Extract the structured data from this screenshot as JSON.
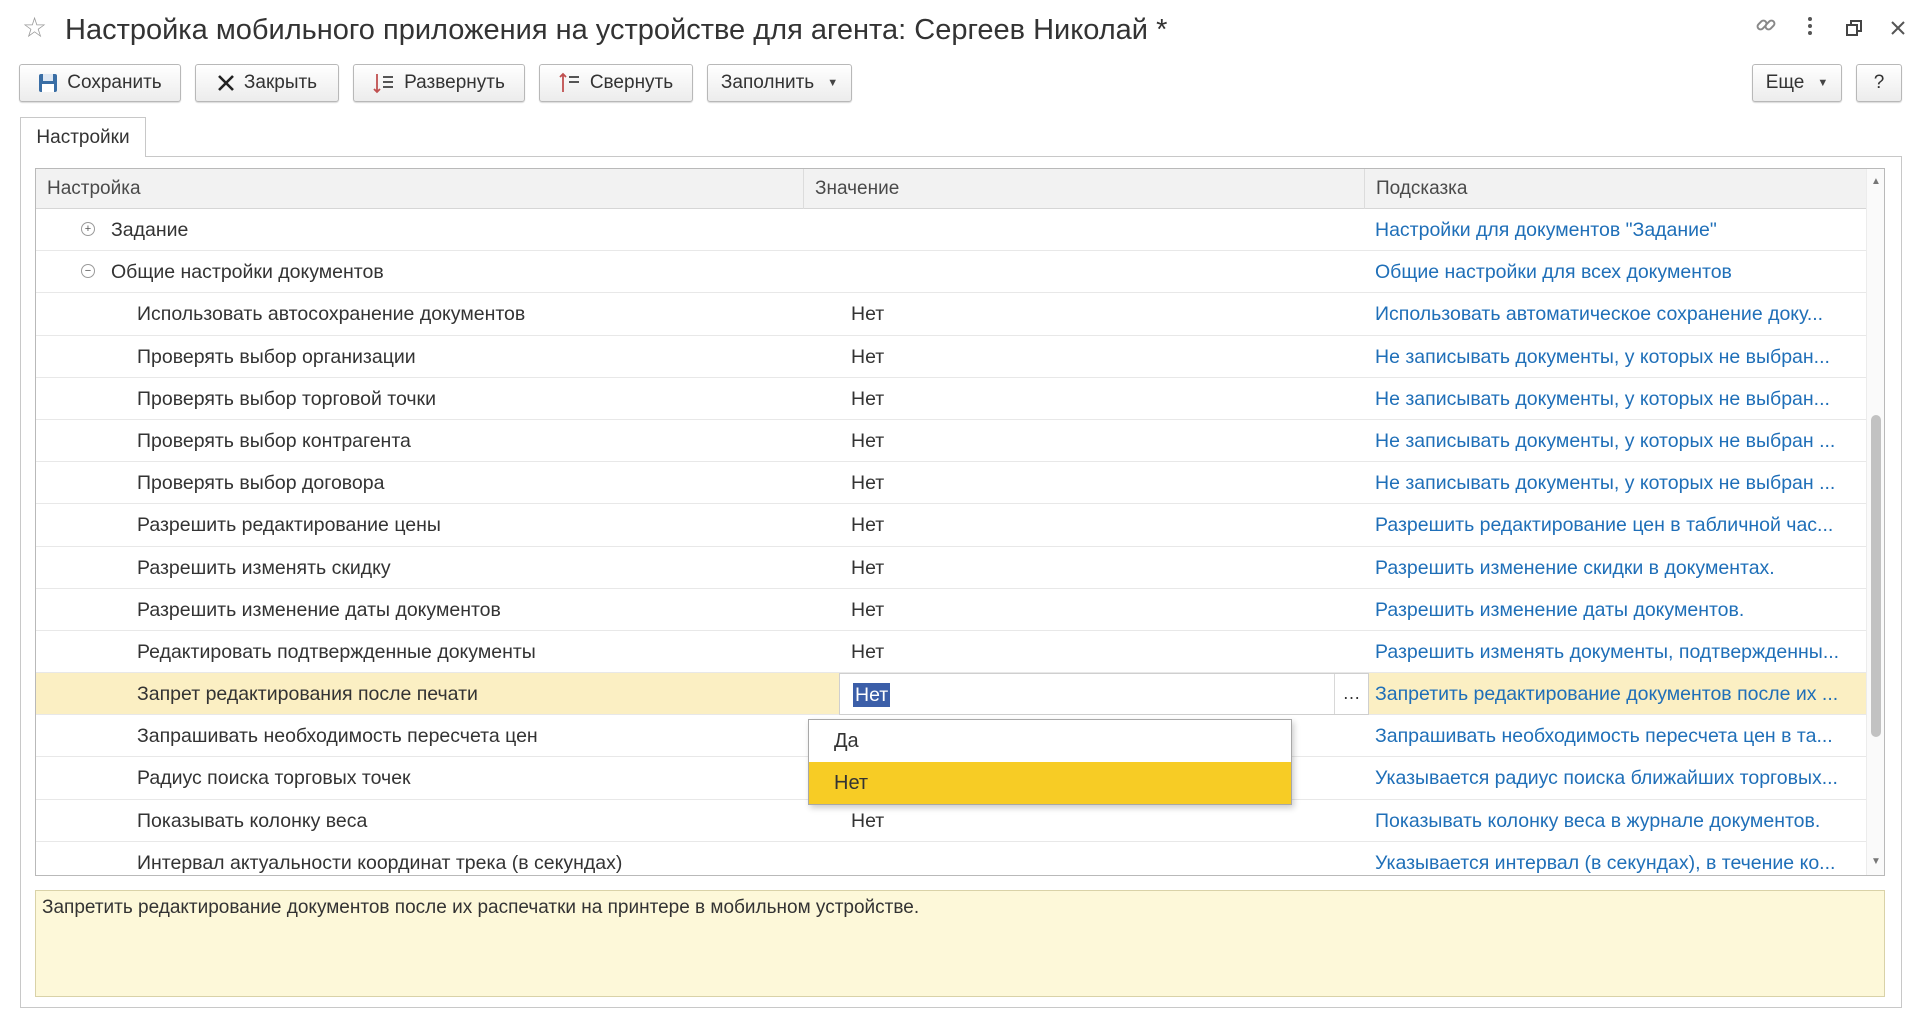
{
  "window": {
    "title": "Настройка мобильного приложения на устройстве для агента: Сергеев Николай *",
    "icons": [
      "star-icon",
      "link-icon",
      "more-vertical-icon",
      "restore-icon",
      "close-icon"
    ]
  },
  "toolbar": {
    "save_label": "Сохранить",
    "close_label": "Закрыть",
    "expand_label": "Развернуть",
    "collapse_label": "Свернуть",
    "fill_label": "Заполнить",
    "more_label": "Еще",
    "help_label": "?"
  },
  "tabs": [
    {
      "label": "Настройки"
    }
  ],
  "table": {
    "columns": [
      "Настройка",
      "Значение",
      "Подсказка"
    ],
    "rows": [
      {
        "setting": "Задание",
        "value": "",
        "hint": "Настройки для документов \"Задание\"",
        "group": true,
        "expanded": false
      },
      {
        "setting": "Общие настройки документов",
        "value": "",
        "hint": "Общие настройки для всех документов",
        "group": true,
        "expanded": true
      },
      {
        "setting": "Использовать автосохранение документов",
        "value": "Нет",
        "hint": "Использовать автоматическое сохранение доку..."
      },
      {
        "setting": "Проверять выбор организации",
        "value": "Нет",
        "hint": "Не записывать документы, у которых не выбран..."
      },
      {
        "setting": "Проверять выбор торговой точки",
        "value": "Нет",
        "hint": "Не записывать документы, у которых не выбран..."
      },
      {
        "setting": "Проверять выбор контрагента",
        "value": "Нет",
        "hint": "Не записывать документы, у которых не выбран ..."
      },
      {
        "setting": "Проверять выбор договора",
        "value": "Нет",
        "hint": "Не записывать документы, у которых не выбран ..."
      },
      {
        "setting": "Разрешить редактирование цены",
        "value": "Нет",
        "hint": "Разрешить редактирование цен в табличной час..."
      },
      {
        "setting": "Разрешить изменять скидку",
        "value": "Нет",
        "hint": "Разрешить изменение скидки в документах."
      },
      {
        "setting": "Разрешить изменение даты документов",
        "value": "Нет",
        "hint": "Разрешить изменение даты документов."
      },
      {
        "setting": "Редактировать подтвержденные документы",
        "value": "Нет",
        "hint": "Разрешить изменять документы, подтвержденны..."
      },
      {
        "setting": "Запрет редактирования после печати",
        "value": "Нет",
        "hint": "Запретить редактирование документов после их ...",
        "selected": true
      },
      {
        "setting": "Запрашивать необходимость пересчета цен",
        "value": "",
        "hint": "Запрашивать необходимость пересчета цен в та..."
      },
      {
        "setting": "Радиус поиска торговых точек",
        "value": "",
        "hint": "Указывается радиус поиска ближайших торговых..."
      },
      {
        "setting": "Показывать колонку веса",
        "value": "Нет",
        "hint": "Показывать колонку веса в журнале документов."
      },
      {
        "setting": "Интервал актуальности координат трека (в секундах)",
        "value": "",
        "hint": "Указывается интервал (в секундах), в течение ко..."
      }
    ]
  },
  "dropdown": {
    "options": [
      "Да",
      "Нет"
    ],
    "selected": "Нет"
  },
  "hint_panel": {
    "text": "Запретить редактирование документов после их распечатки на принтере в мобильном устройстве."
  },
  "colors": {
    "link": "#1f6fb8",
    "selected_row": "#fbefc3",
    "dropdown_highlight": "#f7cc25",
    "hint_background": "#fdf8d9",
    "text_selection": "#3b5ea8"
  }
}
